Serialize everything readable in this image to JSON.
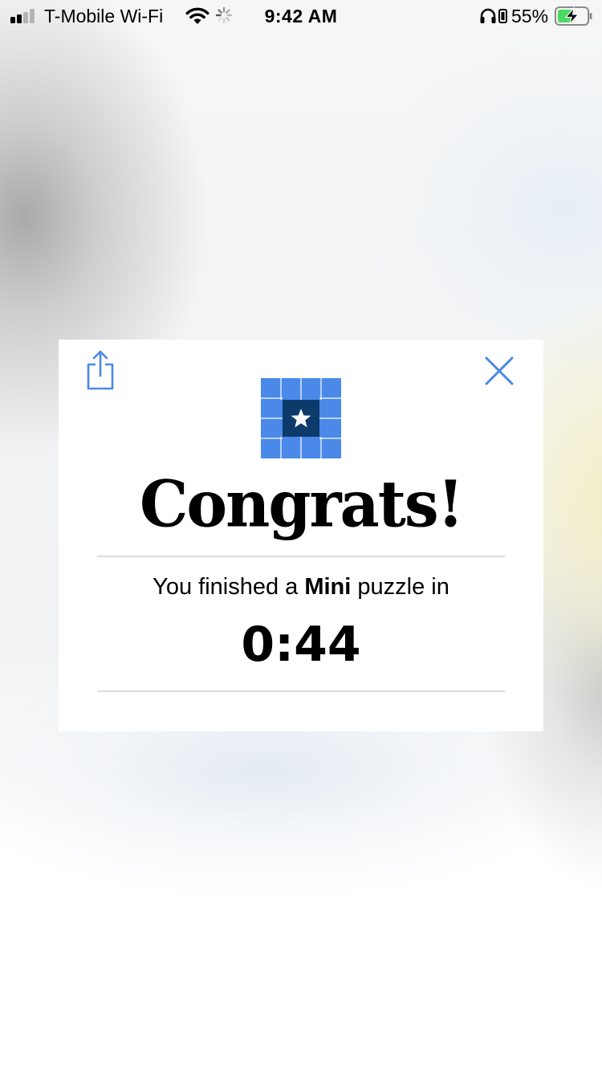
{
  "status_bar": {
    "carrier": "T-Mobile Wi-Fi",
    "time": "9:42 AM",
    "battery_percent": "55%",
    "signal_bars_active": 2,
    "signal_bars_total": 4,
    "battery_level": 0.55,
    "battery_color": "#4cd964",
    "icons": [
      "signal-icon",
      "wifi-icon",
      "activity-spinner-icon",
      "headphones-icon",
      "orientation-lock-icon",
      "battery-charging-icon"
    ]
  },
  "modal": {
    "share_icon": "share-icon",
    "close_icon": "close-icon",
    "logo_icon": "mini-crossword-star-icon",
    "title": "Congrats!",
    "message_prefix": "You finished a ",
    "message_bold": "Mini",
    "message_suffix": " puzzle in",
    "time": "0:44",
    "accent_color": "#4a89e8",
    "logo_center_color": "#0b3a6b"
  }
}
